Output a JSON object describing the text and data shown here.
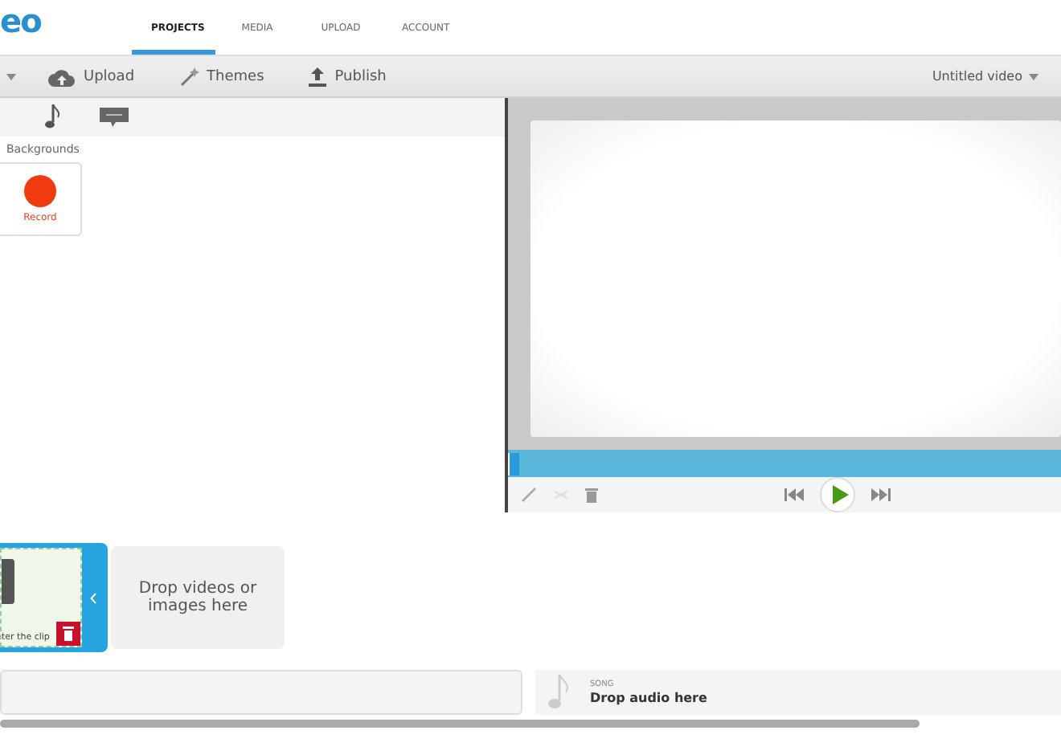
{
  "logo": "eo",
  "nav_tabs": [
    {
      "label": "PROJECTS",
      "selected": true
    },
    {
      "label": "MEDIA",
      "selected": false
    },
    {
      "label": "UPLOAD",
      "selected": false
    },
    {
      "label": "ACCOUNT",
      "selected": false
    }
  ],
  "toolbar": {
    "buttons": [
      {
        "kind": "upload",
        "label": "Upload"
      },
      {
        "kind": "themes",
        "label": "Themes"
      },
      {
        "kind": "publish",
        "label": "Publish"
      }
    ],
    "project_title": "Untitled video"
  },
  "media_tabs": [
    {
      "kind": "music",
      "selected": false
    },
    {
      "kind": "text",
      "selected": false
    }
  ],
  "section_label": "Backgrounds",
  "record_label": "Record",
  "clip": {
    "caption": "ter the clip"
  },
  "drop_zone": "Drop videos or images here",
  "song": {
    "label": "SONG",
    "placeholder": "Drop audio here"
  }
}
